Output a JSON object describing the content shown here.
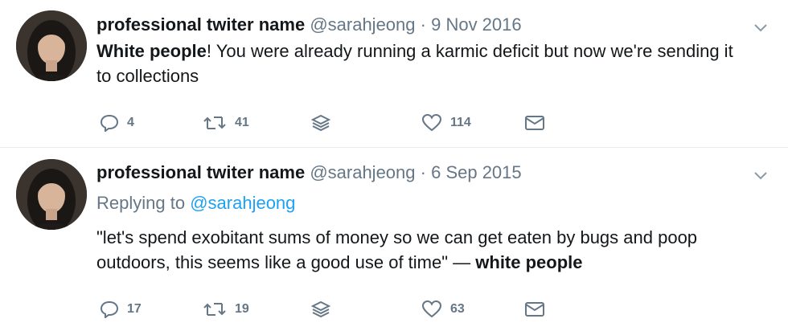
{
  "tweets": [
    {
      "name": "professional twiter name",
      "handle": "@sarahjeong",
      "separator": "·",
      "time": "9 Nov 2016",
      "replying_prefix": "",
      "replying_to": "",
      "text_bold_lead": "White people",
      "text_rest": "! You were already running a karmic deficit but now we're sending it to collections",
      "text_trailing_bold": "",
      "replies": "4",
      "retweets": "41",
      "likes": "114"
    },
    {
      "name": "professional twiter name",
      "handle": "@sarahjeong",
      "separator": "·",
      "time": "6 Sep 2015",
      "replying_prefix": "Replying to",
      "replying_to": "@sarahjeong",
      "text_bold_lead": "",
      "text_rest": "\"let's spend exobitant sums of money so we can get eaten by bugs and poop outdoors, this seems like a good use of time\" — ",
      "text_trailing_bold": "white people",
      "replies": "17",
      "retweets": "19",
      "likes": "63"
    }
  ],
  "colors": {
    "text": "#14171a",
    "muted": "#657786",
    "link": "#1da1f2",
    "divider": "#e6ecf0"
  },
  "icons": [
    "reply-icon",
    "retweet-icon",
    "stack-icon",
    "heart-icon",
    "envelope-icon",
    "chevron-down-icon"
  ]
}
